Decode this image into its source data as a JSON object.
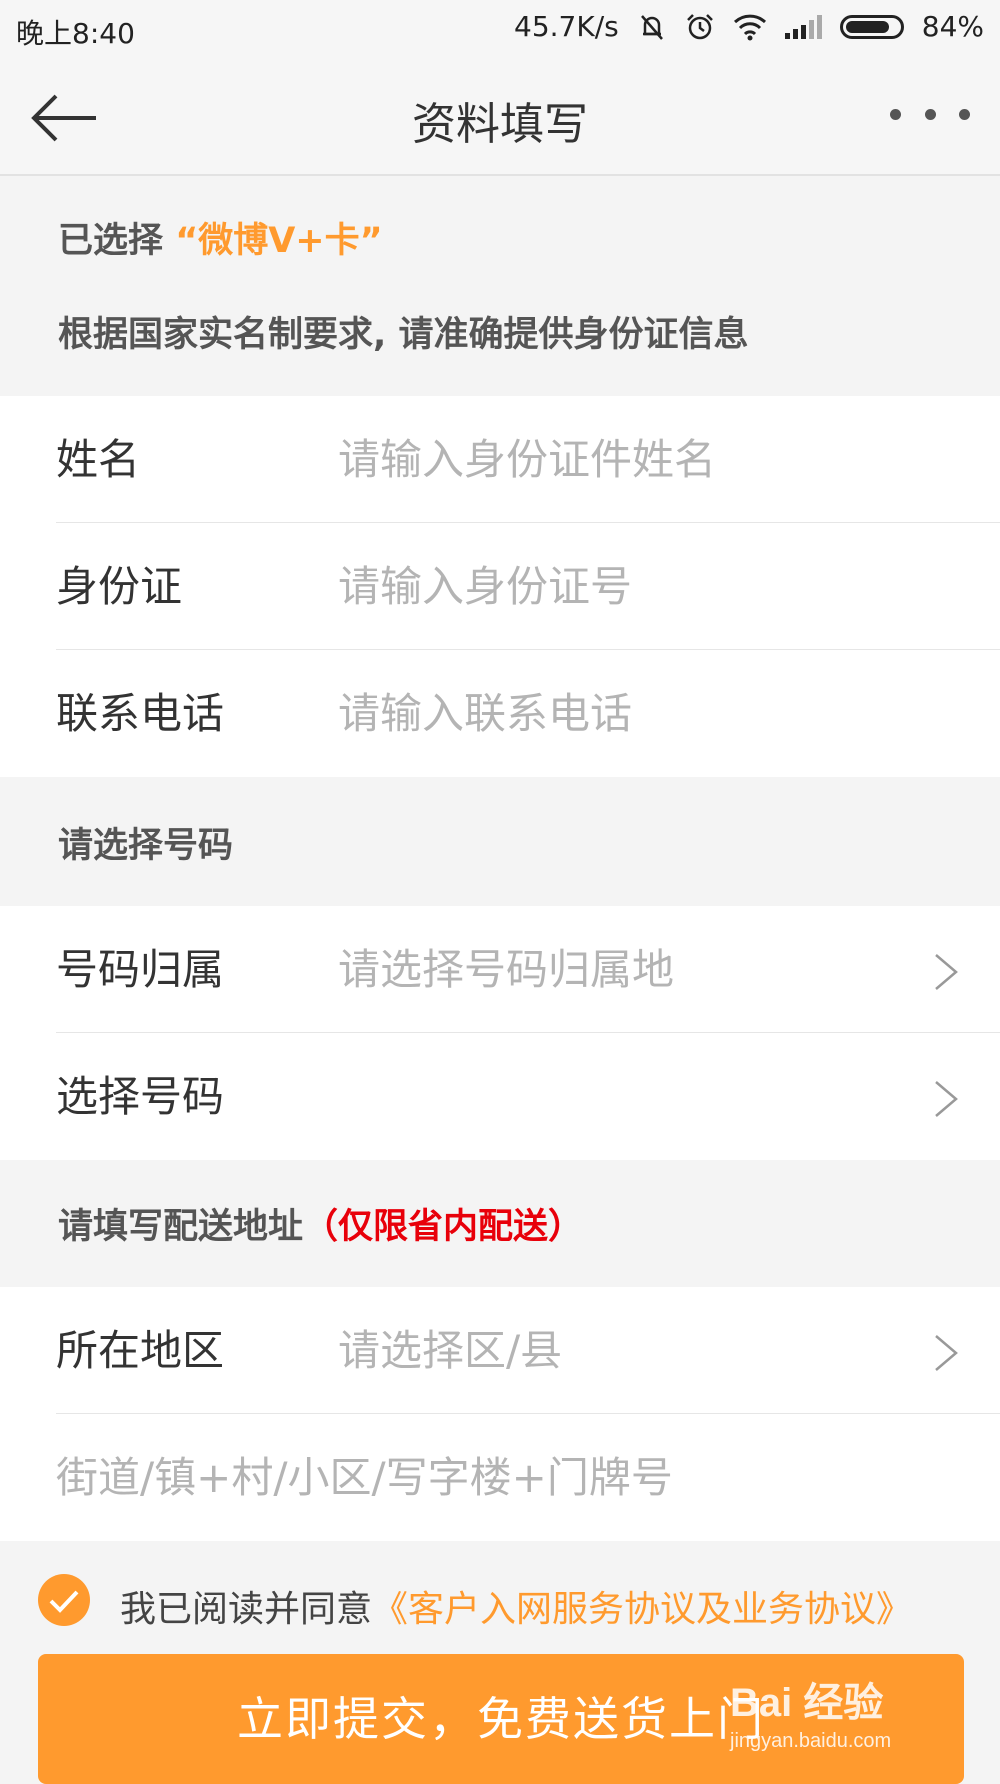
{
  "status_bar": {
    "time": "晚上8:40",
    "speed": "45.7K/s",
    "battery": "84%",
    "battery_level": 0.84
  },
  "nav": {
    "title": "资料填写"
  },
  "intro": {
    "selected_prefix": "已选择",
    "selected_card": "“微博V+卡”",
    "notice": "根据国家实名制要求, 请准确提供身份证信息"
  },
  "identity": {
    "name_label": "姓名",
    "name_placeholder": "请输入身份证件姓名",
    "id_label": "身份证",
    "id_placeholder": "请输入身份证号",
    "phone_label": "联系电话",
    "phone_placeholder": "请输入联系电话"
  },
  "number_section": {
    "header": "请选择号码",
    "location_label": "号码归属",
    "location_placeholder": "请选择号码归属地",
    "choose_label": "选择号码"
  },
  "address_section": {
    "header": "请填写配送地址",
    "header_note": "（仅限省内配送）",
    "region_label": "所在地区",
    "region_placeholder": "请选择区/县",
    "street_placeholder": "街道/镇+村/小区/写字楼+门牌号"
  },
  "agreement": {
    "text": "我已阅读并同意",
    "link": "《客户入网服务协议及业务协议》",
    "checked": true
  },
  "submit": {
    "label": "立即提交，免费送货上门"
  },
  "watermark": {
    "logo": "Bai 经验",
    "sub": "jingyan.baidu.com"
  },
  "colors": {
    "accent": "#ff9a2e",
    "warning": "#e8000a"
  }
}
